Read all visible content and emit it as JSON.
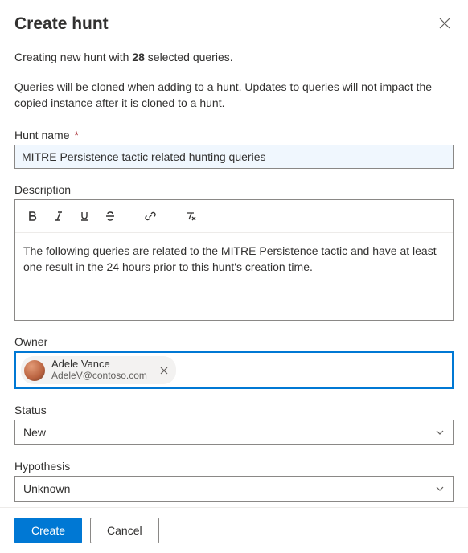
{
  "header": {
    "title": "Create hunt"
  },
  "intro": {
    "prefix": "Creating new hunt with ",
    "count": "28",
    "suffix": " selected queries."
  },
  "note": "Queries will be cloned when adding to a hunt. Updates to queries will not impact the copied instance after it is cloned to a hunt.",
  "huntName": {
    "label": "Hunt name",
    "required_marker": "*",
    "value": "MITRE Persistence tactic related hunting queries"
  },
  "description": {
    "label": "Description",
    "body": "The following queries are related to the MITRE Persistence tactic and have at least one result in the 24 hours prior to this hunt's creation time."
  },
  "owner": {
    "label": "Owner",
    "person": {
      "name": "Adele Vance",
      "email": "AdeleV@contoso.com"
    }
  },
  "status": {
    "label": "Status",
    "value": "New"
  },
  "hypothesis": {
    "label": "Hypothesis",
    "value": "Unknown"
  },
  "footer": {
    "create": "Create",
    "cancel": "Cancel"
  }
}
